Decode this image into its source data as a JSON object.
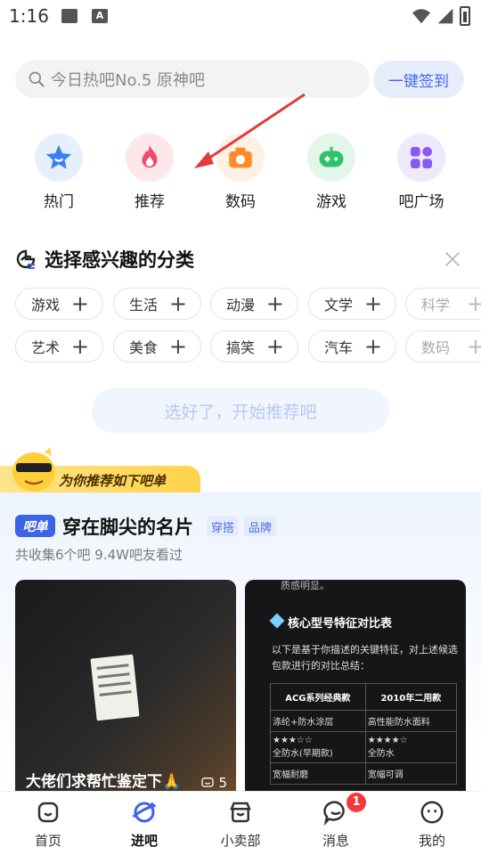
{
  "status_bar": {
    "time": "1:16",
    "icons": [
      "photo-icon",
      "text-icon",
      "wifi-icon",
      "signal-icon",
      "battery-charging-icon"
    ]
  },
  "search": {
    "placeholder": "今日热吧No.5 原神吧",
    "signin_label": "一键签到"
  },
  "categories": [
    {
      "label": "热门",
      "icon": "star-icon",
      "color": "#3d7ff0"
    },
    {
      "label": "推荐",
      "icon": "flame-icon",
      "color": "#f04a6a"
    },
    {
      "label": "数码",
      "icon": "camera-icon",
      "color": "#ff8a2a"
    },
    {
      "label": "游戏",
      "icon": "gamepad-icon",
      "color": "#2ec26a"
    },
    {
      "label": "吧广场",
      "icon": "grid-icon",
      "color": "#8a5af0"
    }
  ],
  "interest": {
    "title": "选择感兴趣的分类",
    "chips_row1": [
      "游戏",
      "生活",
      "动漫",
      "文学",
      "科学"
    ],
    "chips_row2": [
      "艺术",
      "美食",
      "搞笑",
      "汽车",
      "数码"
    ],
    "start_label": "选好了，开始推荐吧"
  },
  "recommend_banner": {
    "text": "为你推荐如下吧单"
  },
  "topic": {
    "tag": "吧单",
    "title": "穿在脚尖的名片",
    "badges": [
      "穿搭",
      "品牌"
    ],
    "subtitle": "共收集6个吧 9.4W吧友看过"
  },
  "cards": {
    "left": {
      "title": "大佬们求帮忙鉴定下🙏",
      "count": "5"
    },
    "right": {
      "top_text": "质感明显。",
      "heading": "核心型号特征对比表",
      "paragraph": "以下是基于你描述的关键特征，对上述候选包款进行的对比总结：",
      "table_headers": [
        "ACG系列经典款",
        "2010年二用款"
      ],
      "table_rows": [
        [
          "涤纶+防水涂层",
          "高性能防水面料"
        ],
        [
          "★★★☆☆\n全防水(早期款)",
          "★★★★☆\n全防水"
        ],
        [
          "宽幅耐磨",
          "宽幅可调"
        ]
      ]
    }
  },
  "bottom_nav": [
    {
      "label": "首页",
      "icon": "home-icon"
    },
    {
      "label": "进吧",
      "icon": "planet-icon",
      "active": true
    },
    {
      "label": "小卖部",
      "icon": "shop-icon"
    },
    {
      "label": "消息",
      "icon": "message-icon",
      "badge": "1"
    },
    {
      "label": "我的",
      "icon": "profile-icon"
    }
  ]
}
